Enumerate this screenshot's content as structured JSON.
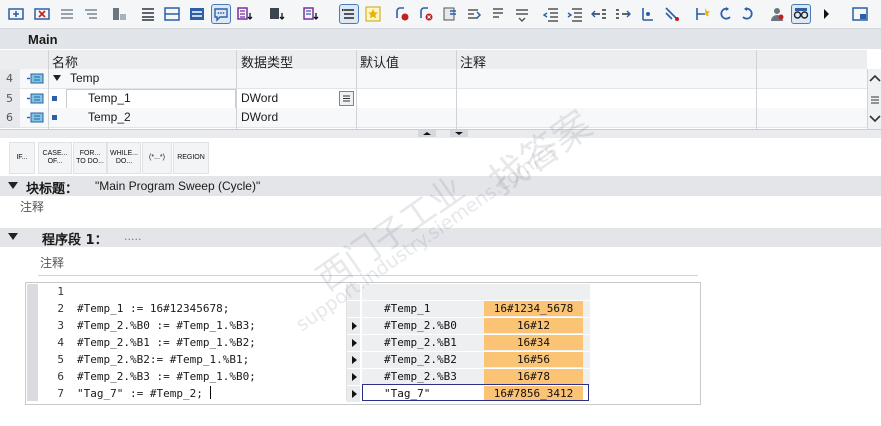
{
  "block": {
    "name": "Main"
  },
  "interface": {
    "columns": [
      "名称",
      "数据类型",
      "默认值",
      "注释"
    ],
    "rows": [
      {
        "num": "4",
        "name": "Temp",
        "type": "",
        "expanded": true
      },
      {
        "num": "5",
        "name": "Temp_1",
        "type": "DWord"
      },
      {
        "num": "6",
        "name": "Temp_2",
        "type": "DWord"
      }
    ]
  },
  "instructions": [
    "IF...",
    "CASE... OF...",
    "FOR... TO DO...",
    "WHILE... DO...",
    "(*...*)",
    "REGION"
  ],
  "block_title": {
    "label": "块标题：",
    "value": "\"Main Program Sweep (Cycle)\"",
    "comment": "注释"
  },
  "network": {
    "label": "程序段 1：",
    "dots": ".....",
    "comment": "注释"
  },
  "code": {
    "line_numbers": [
      "1",
      "2",
      "3",
      "4",
      "5",
      "6",
      "7"
    ],
    "lines": [
      "",
      "#Temp_1 := 16#12345678;",
      "#Temp_2.%B0 := #Temp_1.%B3;",
      "#Temp_2.%B1 := #Temp_1.%B2;",
      "#Temp_2.%B2:= #Temp_1.%B1;",
      "#Temp_2.%B3 := #Temp_1.%B0;",
      "\"Tag_7\" := #Temp_2;"
    ]
  },
  "watch": [
    {
      "name": "#Temp_1",
      "value": "16#1234_5678"
    },
    {
      "name": "#Temp_2.%B0",
      "value": "16#12"
    },
    {
      "name": "#Temp_2.%B1",
      "value": "16#34"
    },
    {
      "name": "#Temp_2.%B2",
      "value": "16#56"
    },
    {
      "name": "#Temp_2.%B3",
      "value": "16#78"
    },
    {
      "name": "\"Tag_7\"",
      "value": "16#7856_3412"
    }
  ],
  "watermark": {
    "cn1": "找答案",
    "cn2": "西门子工业",
    "url": "support.industry.siemens.com/cs"
  },
  "colors": {
    "monitor_value": "#fbc374",
    "header_bg": "#e3e5e8",
    "accent": "#2d5fa8"
  },
  "icons": [
    "insert-network-icon",
    "delete-network-icon",
    "open-networks-icon",
    "close-networks-icon",
    "toggle-lad-icon",
    "navigation-icon",
    "split-view-icon",
    "absolute-operands-icon",
    "comment-icon",
    "favorites-icon",
    "breakpoint-icon",
    "indent-icon",
    "outdent-icon",
    "monitoring-icon",
    "glasses-icon",
    "more-arrow-icon",
    "maximize-icon"
  ]
}
